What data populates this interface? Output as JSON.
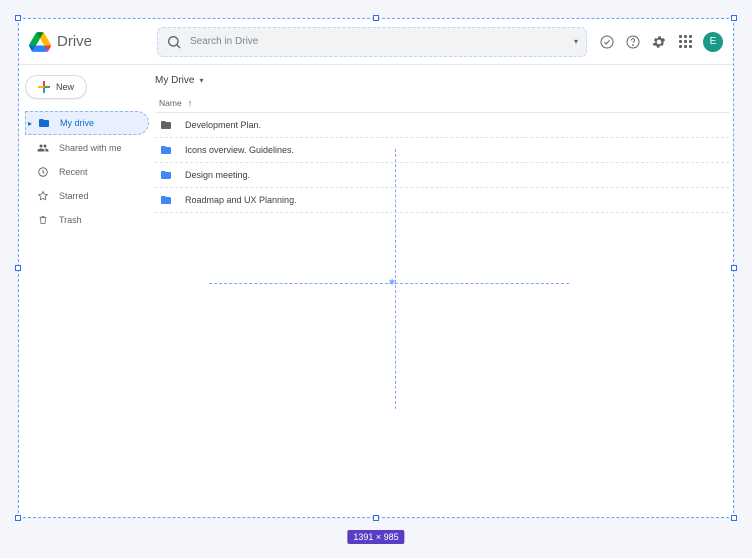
{
  "app": {
    "name": "Drive"
  },
  "header": {
    "search_placeholder": "Search in Drive",
    "avatar_letter": "E"
  },
  "sidebar": {
    "new_label": "New",
    "items": [
      {
        "label": "My drive",
        "icon": "folder-icon",
        "active": true,
        "expandable": true
      },
      {
        "label": "Shared with me",
        "icon": "people-icon",
        "active": false
      },
      {
        "label": "Recent",
        "icon": "clock-icon",
        "active": false
      },
      {
        "label": "Starred",
        "icon": "star-icon",
        "active": false
      },
      {
        "label": "Trash",
        "icon": "trash-icon",
        "active": false
      }
    ]
  },
  "main": {
    "breadcrumb": "My Drive",
    "column_header": "Name",
    "items": [
      {
        "name": "Development Plan.",
        "color": "dark"
      },
      {
        "name": "Icons overview. Guidelines.",
        "color": "blue"
      },
      {
        "name": "Design meeting.",
        "color": "blue"
      },
      {
        "name": "Roadmap and UX Planning.",
        "color": "blue"
      }
    ]
  },
  "design_tool": {
    "frame_size_label": "1391 × 985"
  }
}
